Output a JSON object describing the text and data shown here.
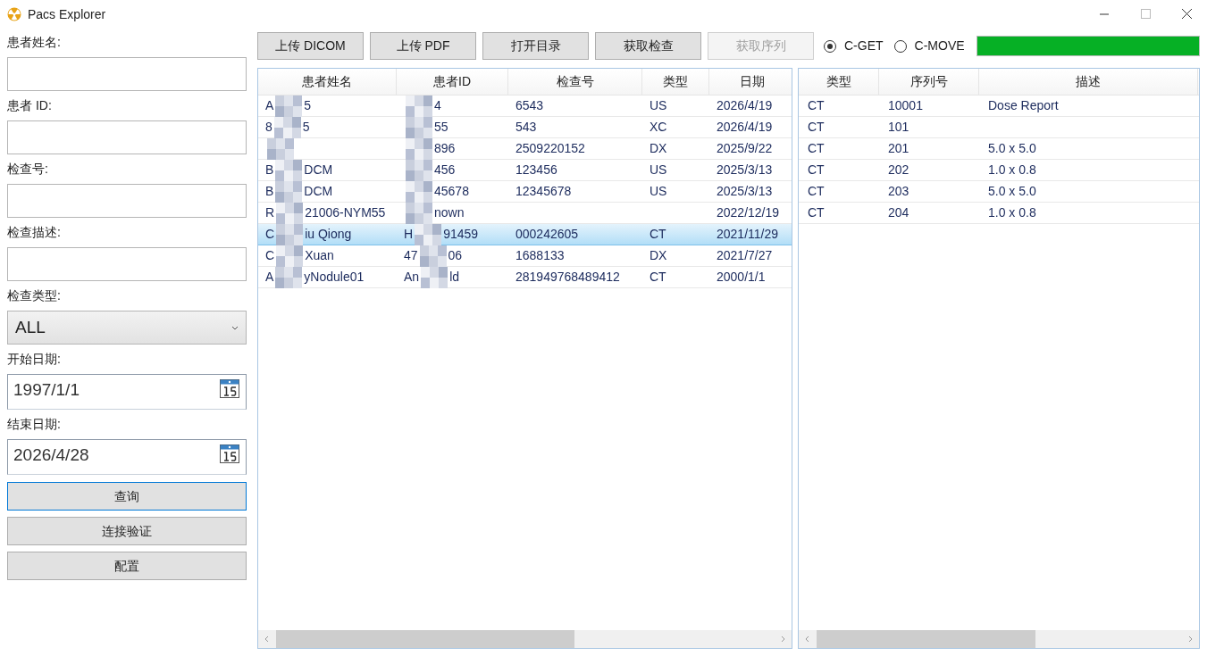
{
  "window": {
    "title": "Pacs Explorer"
  },
  "form": {
    "fields": [
      {
        "label": "患者姓名:",
        "kind": "text"
      },
      {
        "label": "患者 ID:",
        "kind": "text"
      },
      {
        "label": "检查号:",
        "kind": "text"
      },
      {
        "label": "检查描述:",
        "kind": "text"
      },
      {
        "label": "检查类型:",
        "kind": "select",
        "value": "ALL"
      },
      {
        "label": "开始日期:",
        "kind": "date",
        "value": "1997/1/1"
      },
      {
        "label": "结束日期:",
        "kind": "date",
        "value": "2026/4/28"
      }
    ],
    "buttons": [
      {
        "label": "查询",
        "focused": true
      },
      {
        "label": "连接验证",
        "focused": false
      },
      {
        "label": "配置",
        "focused": false
      }
    ]
  },
  "toolbar": {
    "buttons": [
      {
        "label": "上传 DICOM",
        "disabled": false
      },
      {
        "label": "上传 PDF",
        "disabled": false
      },
      {
        "label": "打开目录",
        "disabled": false
      },
      {
        "label": "获取检查",
        "disabled": false
      },
      {
        "label": "获取序列",
        "disabled": true
      }
    ],
    "radios": [
      {
        "label": "C-GET",
        "selected": true
      },
      {
        "label": "C-MOVE",
        "selected": false
      }
    ],
    "progress": {
      "level": 1
    }
  },
  "studies": {
    "columns": [
      "患者姓名",
      "患者ID",
      "检查号",
      "类型",
      "日期"
    ],
    "rows": [
      {
        "selected": false,
        "cells": [
          [
            "A",
            null,
            "5"
          ],
          [
            null,
            "4"
          ],
          [
            "6543"
          ],
          [
            "US"
          ],
          [
            "2026/4/19"
          ]
        ]
      },
      {
        "selected": false,
        "cells": [
          [
            "8",
            null,
            "5"
          ],
          [
            null,
            "55"
          ],
          [
            "543"
          ],
          [
            "XC"
          ],
          [
            "2026/4/19"
          ]
        ]
      },
      {
        "selected": false,
        "cells": [
          [
            null
          ],
          [
            null,
            "896"
          ],
          [
            "2509220152"
          ],
          [
            "DX"
          ],
          [
            "2025/9/22"
          ]
        ]
      },
      {
        "selected": false,
        "cells": [
          [
            "B",
            null,
            "DCM"
          ],
          [
            null,
            "456"
          ],
          [
            "123456"
          ],
          [
            "US"
          ],
          [
            "2025/3/13"
          ]
        ]
      },
      {
        "selected": false,
        "cells": [
          [
            "B",
            null,
            "DCM"
          ],
          [
            null,
            "45678"
          ],
          [
            "12345678"
          ],
          [
            "US"
          ],
          [
            "2025/3/13"
          ]
        ]
      },
      {
        "selected": false,
        "cells": [
          [
            "R",
            null,
            "21006-NYM55"
          ],
          [
            null,
            "nown"
          ],
          [],
          [],
          [
            "2022/12/19"
          ]
        ]
      },
      {
        "selected": true,
        "cells": [
          [
            "C",
            null,
            "iu Qiong"
          ],
          [
            "H",
            null,
            "91459"
          ],
          [
            "000242605"
          ],
          [
            "CT"
          ],
          [
            "2021/11/29"
          ]
        ]
      },
      {
        "selected": false,
        "cells": [
          [
            "C",
            null,
            "Xuan"
          ],
          [
            "47",
            null,
            "06"
          ],
          [
            "1688133"
          ],
          [
            "DX"
          ],
          [
            "2021/7/27"
          ]
        ]
      },
      {
        "selected": false,
        "cells": [
          [
            "A",
            null,
            "yNodule01"
          ],
          [
            "An",
            null,
            "ld"
          ],
          [
            "281949768489412"
          ],
          [
            "CT"
          ],
          [
            "2000/1/1"
          ]
        ]
      }
    ]
  },
  "series": {
    "columns": [
      "类型",
      "序列号",
      "描述"
    ],
    "rows": [
      {
        "cells": [
          "CT",
          "10001",
          "Dose Report"
        ]
      },
      {
        "cells": [
          "CT",
          "101"
        ]
      },
      {
        "cells": [
          "CT",
          "201",
          "5.0 x 5.0"
        ]
      },
      {
        "cells": [
          "CT",
          "202",
          "1.0 x 0.8"
        ]
      },
      {
        "cells": [
          "CT",
          "203",
          "5.0 x 5.0"
        ]
      },
      {
        "cells": [
          "CT",
          "204",
          "1.0 x 0.8"
        ]
      }
    ]
  }
}
